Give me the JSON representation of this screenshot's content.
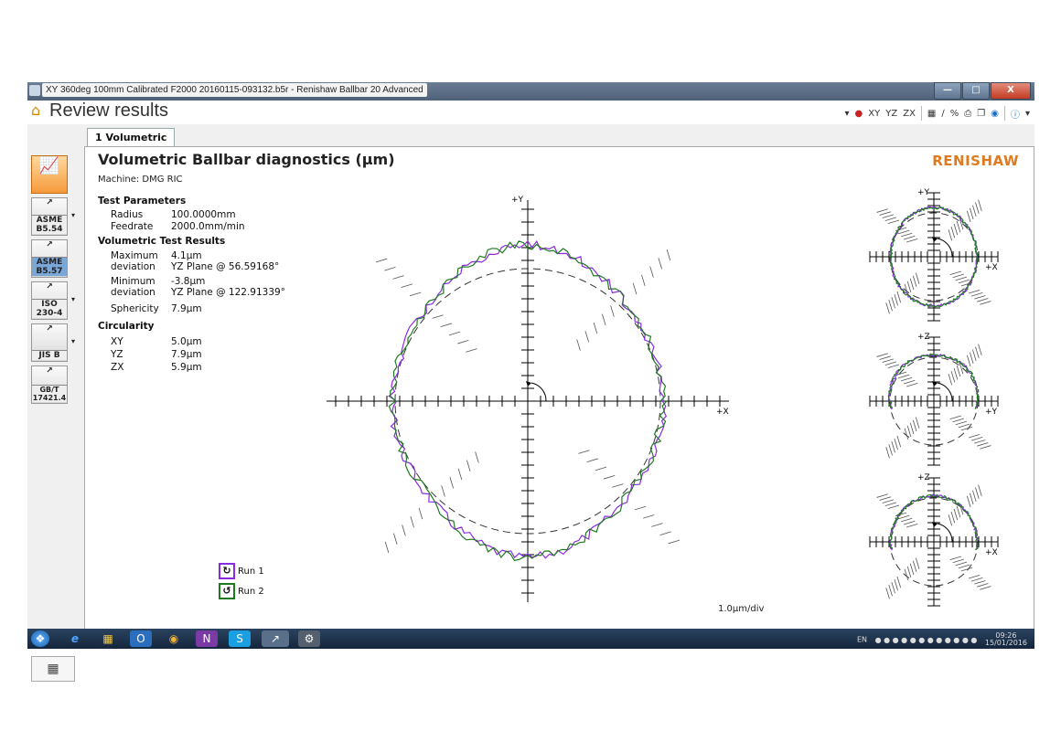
{
  "window": {
    "title": "XY 360deg 100mm Calibrated F2000 20160115-093132.b5r - Renishaw Ballbar 20 Advanced",
    "min_label": "—",
    "max_label": "□",
    "close_label": "X"
  },
  "header": {
    "title": "Review results",
    "tools": [
      "XY",
      "YZ",
      "ZX"
    ]
  },
  "tabs": [
    {
      "label": "1 Volumetric"
    }
  ],
  "sidebar": {
    "buttons": [
      {
        "label": ""
      },
      {
        "label": "ASME B5.54"
      },
      {
        "label": "ASME B5.57"
      },
      {
        "label": "ISO 230-4"
      },
      {
        "label": "JIS B"
      },
      {
        "label": "GB/T 17421.4"
      }
    ]
  },
  "main": {
    "title": "Volumetric Ballbar diagnostics (µm)",
    "machine": "Machine: DMG RIC",
    "brand": "RENISHAW",
    "test_parameters": {
      "heading": "Test Parameters",
      "radius_label": "Radius",
      "radius_value": "100.0000mm",
      "feedrate_label": "Feedrate",
      "feedrate_value": "2000.0mm/min"
    },
    "results": {
      "heading": "Volumetric Test Results",
      "max_label": "Maximum deviation",
      "max_value": "4.1µm",
      "max_plane": "YZ Plane @ 56.59168°",
      "min_label": "Minimum deviation",
      "min_value": "-3.8µm",
      "min_plane": "YZ Plane @ 122.91339°",
      "sphericity_label": "Sphericity",
      "sphericity_value": "7.9µm"
    },
    "circularity": {
      "heading": "Circularity",
      "rows": [
        {
          "plane": "XY",
          "value": "5.0µm"
        },
        {
          "plane": "YZ",
          "value": "7.9µm"
        },
        {
          "plane": "ZX",
          "value": "5.9µm"
        }
      ]
    },
    "plot_labels": {
      "main_y": "+Y",
      "main_x": "+X",
      "xy_y": "+Y",
      "xy_x": "+X",
      "yz_z": "+Z",
      "yz_y": "+Y",
      "zx_z": "+Z",
      "zx_x": "+X"
    },
    "legend": [
      {
        "label": "Run 1"
      },
      {
        "label": "Run 2"
      }
    ],
    "scale": "1.0µm/div"
  },
  "colors": {
    "run1": "#8a2be2",
    "run2": "#1f7a1f",
    "brand": "#e07a1f"
  },
  "taskbar": {
    "lang": "EN",
    "time": "09:26",
    "date": "15/01/2016"
  }
}
